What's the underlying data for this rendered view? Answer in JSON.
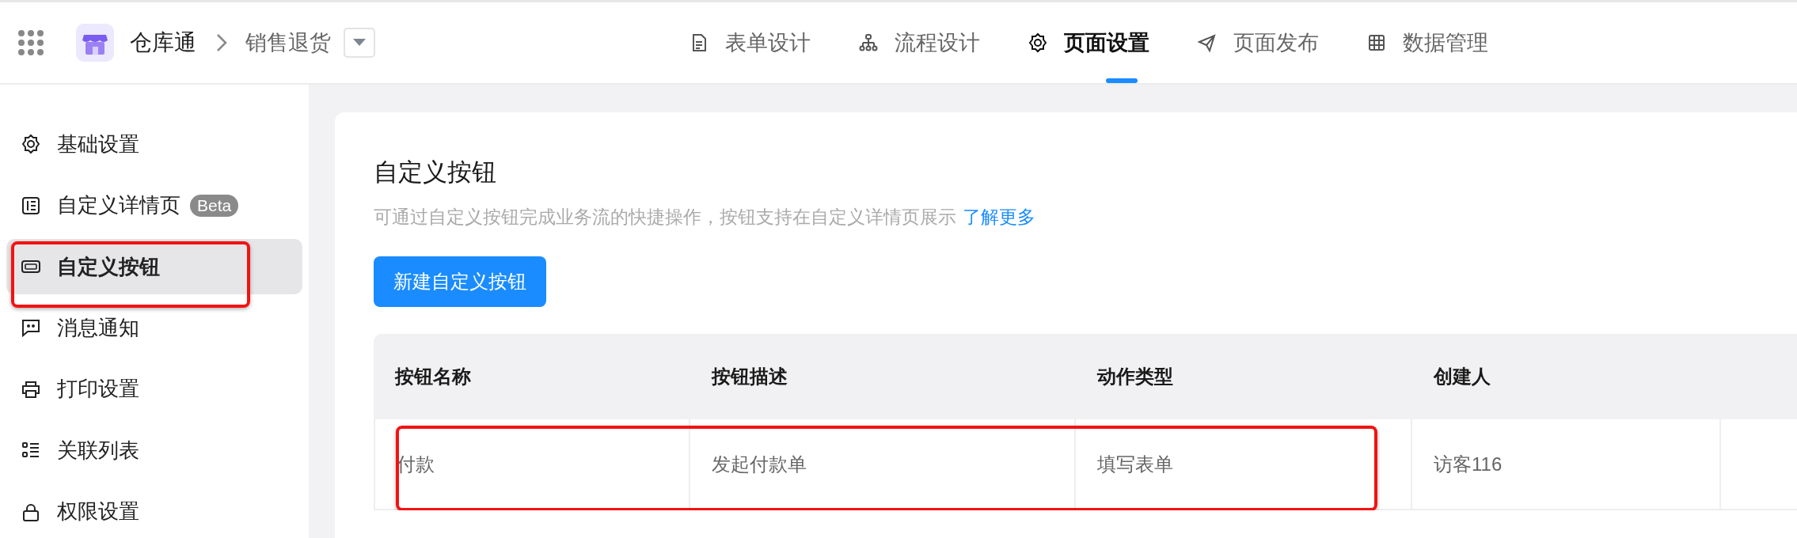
{
  "header": {
    "app_name": "仓库通",
    "breadcrumb": "销售退货",
    "tabs": [
      {
        "label": "表单设计",
        "selected": false
      },
      {
        "label": "流程设计",
        "selected": false
      },
      {
        "label": "页面设置",
        "selected": true
      },
      {
        "label": "页面发布",
        "selected": false
      },
      {
        "label": "数据管理",
        "selected": false
      }
    ]
  },
  "sidebar": {
    "items": [
      {
        "label": "基础设置",
        "selected": false,
        "highlighted": false
      },
      {
        "label": "自定义详情页",
        "badge": "Beta",
        "selected": false,
        "highlighted": false
      },
      {
        "label": "自定义按钮",
        "selected": true,
        "highlighted": true
      },
      {
        "label": "消息通知",
        "selected": false,
        "highlighted": false
      },
      {
        "label": "打印设置",
        "selected": false,
        "highlighted": false
      },
      {
        "label": "关联列表",
        "selected": false,
        "highlighted": false
      },
      {
        "label": "权限设置",
        "selected": false,
        "highlighted": false
      }
    ]
  },
  "content": {
    "title": "自定义按钮",
    "description": "可通过自定义按钮完成业务流的快捷操作，按钮支持在自定义详情页展示",
    "link": "了解更多",
    "new_button": "新建自定义按钮",
    "table": {
      "columns": [
        "按钮名称",
        "按钮描述",
        "动作类型",
        "创建人"
      ],
      "rows": [
        {
          "cells": [
            "付款",
            "发起付款单",
            "填写表单",
            "访客116"
          ],
          "highlighted": true
        }
      ]
    }
  }
}
